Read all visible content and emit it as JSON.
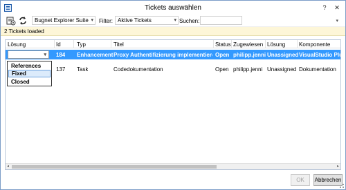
{
  "window": {
    "title": "Tickets auswählen"
  },
  "title_buttons": {
    "help": "?",
    "close": "✕"
  },
  "toolbar": {
    "project_value": "Bugnet Explorer Suite",
    "filter_label": "Filter:",
    "filter_value": "Aktive Tickets",
    "search_label": "Suchen:",
    "search_value": "",
    "overflow": "▾"
  },
  "status": {
    "text": "2 Tickets loaded"
  },
  "grid": {
    "columns": [
      "Lösung",
      "Id",
      "Typ",
      "Titel",
      "Status",
      "Zugewiesen",
      "Lösung",
      "Komponente"
    ],
    "rows": [
      {
        "resolution": "",
        "id": "184",
        "type": "Enhancement",
        "title": "Proxy Authentifizierung implementieren.",
        "status": "Open",
        "assigned": "philipp.jenni",
        "resolution2": "Unassigned",
        "component": "VisualStudio Plugi"
      },
      {
        "resolution": "",
        "id": "137",
        "type": "Task",
        "title": "Codedokumentation",
        "status": "Open",
        "assigned": "philipp.jenni",
        "resolution2": "Unassigned",
        "component": "Dokumentation"
      }
    ]
  },
  "dropdown": {
    "items": [
      "References",
      "Fixed",
      "Closed"
    ],
    "highlighted": "Fixed"
  },
  "buttons": {
    "ok": "OK",
    "cancel": "Abbrechen"
  },
  "icons": {
    "arrow_down": "▾",
    "scroll_left": "◂",
    "scroll_right": "▸"
  },
  "colors": {
    "selection": "#3399ff",
    "status_bar": "#fdf6d8",
    "dropdown_highlight": "#dcebfb"
  }
}
